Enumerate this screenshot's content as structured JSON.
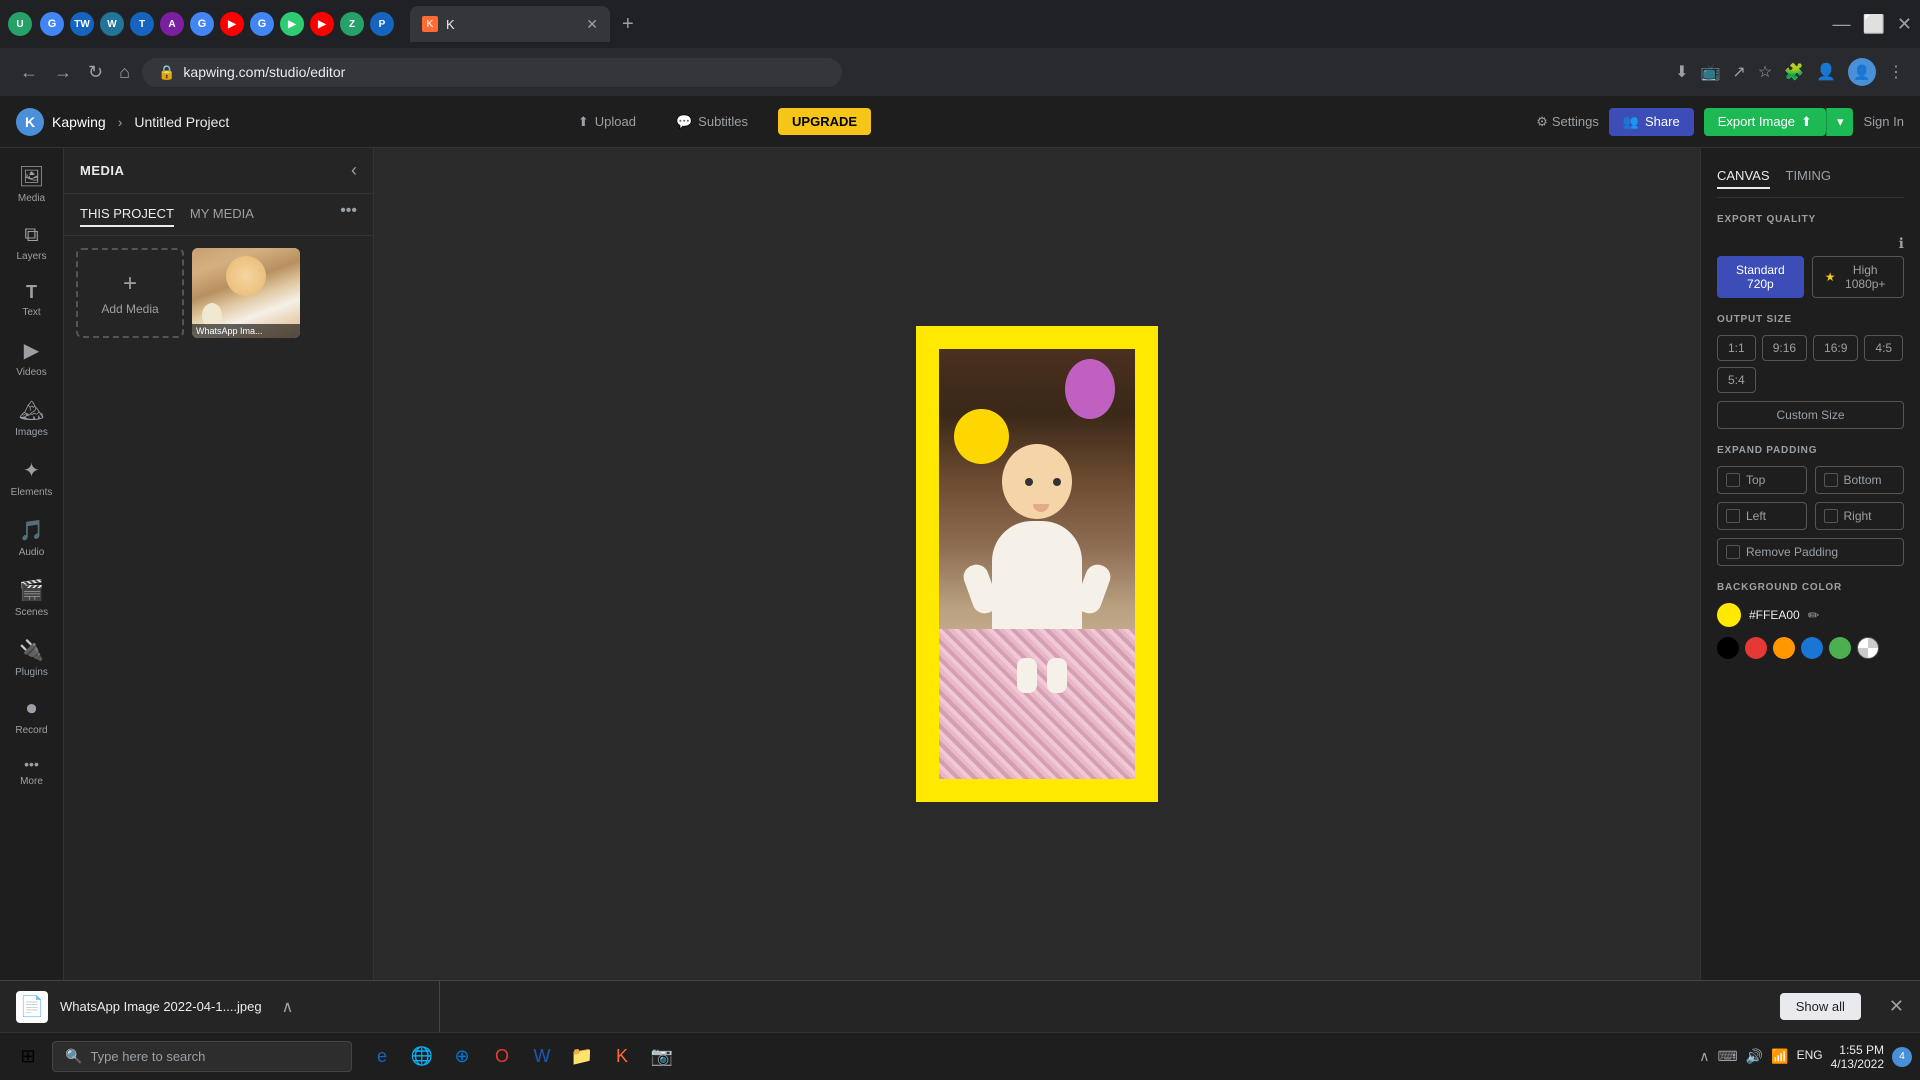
{
  "browser": {
    "url": "kapwing.com/studio/editor",
    "tab_title": "K",
    "tab_close": "✕",
    "new_tab": "+"
  },
  "app": {
    "logo_letter": "K",
    "brand": "Kapwing",
    "breadcrumb_sep": "›",
    "project_name": "Untitled Project",
    "header": {
      "upload_label": "Upload",
      "subtitles_label": "Subtitles",
      "upgrade_label": "UPGRADE",
      "settings_label": "Settings",
      "share_label": "Share",
      "export_label": "Export Image",
      "signin_label": "Sign In"
    },
    "left_sidebar": {
      "items": [
        {
          "id": "media",
          "label": "Media",
          "icon": "🖼"
        },
        {
          "id": "layers",
          "label": "Layers",
          "icon": "⧉"
        },
        {
          "id": "text",
          "label": "Text",
          "icon": "T"
        },
        {
          "id": "videos",
          "label": "Videos",
          "icon": "▶"
        },
        {
          "id": "images",
          "label": "Images",
          "icon": "🏔"
        },
        {
          "id": "elements",
          "label": "Elements",
          "icon": "✦"
        },
        {
          "id": "audio",
          "label": "Audio",
          "icon": "🎵"
        },
        {
          "id": "scenes",
          "label": "Scenes",
          "icon": "🎬"
        },
        {
          "id": "plugins",
          "label": "Plugins",
          "icon": "🔌"
        },
        {
          "id": "record",
          "label": "Record",
          "icon": "⏺"
        },
        {
          "id": "more",
          "label": "More",
          "icon": "•••"
        }
      ]
    },
    "media_panel": {
      "title": "MEDIA",
      "tabs": [
        {
          "label": "THIS PROJECT",
          "active": true
        },
        {
          "label": "MY MEDIA",
          "active": false
        }
      ],
      "add_media_label": "Add Media",
      "media_file": "WhatsApp Ima..."
    },
    "right_panel": {
      "tabs": [
        {
          "label": "CANVAS",
          "active": true
        },
        {
          "label": "TIMING",
          "active": false
        }
      ],
      "export_quality": {
        "title": "EXPORT QUALITY",
        "standard_label": "Standard 720p",
        "high_label": "High 1080p+"
      },
      "output_size": {
        "title": "OUTPUT SIZE",
        "sizes": [
          "1:1",
          "9:16",
          "16:9",
          "4:5",
          "5:4"
        ],
        "custom_label": "Custom Size"
      },
      "expand_padding": {
        "title": "EXPAND PADDING",
        "top_label": "Top",
        "bottom_label": "Bottom",
        "left_label": "Left",
        "right_label": "Right",
        "remove_label": "Remove Padding"
      },
      "background_color": {
        "title": "BACKGROUND COLOR",
        "hex_value": "#FFEA00",
        "presets": [
          {
            "color": "#000000"
          },
          {
            "color": "#e53935"
          },
          {
            "color": "#ff9800"
          },
          {
            "color": "#1976d2"
          },
          {
            "color": "#4caf50"
          },
          {
            "color": "transparent"
          }
        ]
      }
    }
  },
  "bottom_file_strip": {
    "file_name": "WhatsApp Image 2022-04-1....jpeg",
    "show_all_label": "Show all",
    "close_icon": "✕",
    "collapse_icon": "∧"
  },
  "windows_taskbar": {
    "search_placeholder": "Type here to search",
    "time": "1:55 PM",
    "date": "4/13/2022",
    "lang": "ENG",
    "notification_count": "4"
  }
}
